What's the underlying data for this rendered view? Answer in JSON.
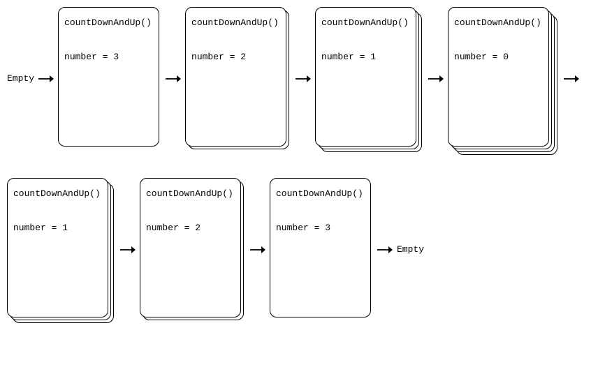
{
  "labels": {
    "empty_start": "Empty",
    "empty_end": "Empty"
  },
  "row1": {
    "stacks": [
      {
        "depth": 1,
        "fn": "countDownAndUp()",
        "var": "number = 3"
      },
      {
        "depth": 2,
        "fn": "countDownAndUp()",
        "var": "number = 2"
      },
      {
        "depth": 3,
        "fn": "countDownAndUp()",
        "var": "number = 1"
      },
      {
        "depth": 4,
        "fn": "countDownAndUp()",
        "var": "number = 0"
      }
    ]
  },
  "row2": {
    "stacks": [
      {
        "depth": 3,
        "fn": "countDownAndUp()",
        "var": "number = 1"
      },
      {
        "depth": 2,
        "fn": "countDownAndUp()",
        "var": "number = 2"
      },
      {
        "depth": 1,
        "fn": "countDownAndUp()",
        "var": "number = 3"
      }
    ]
  }
}
